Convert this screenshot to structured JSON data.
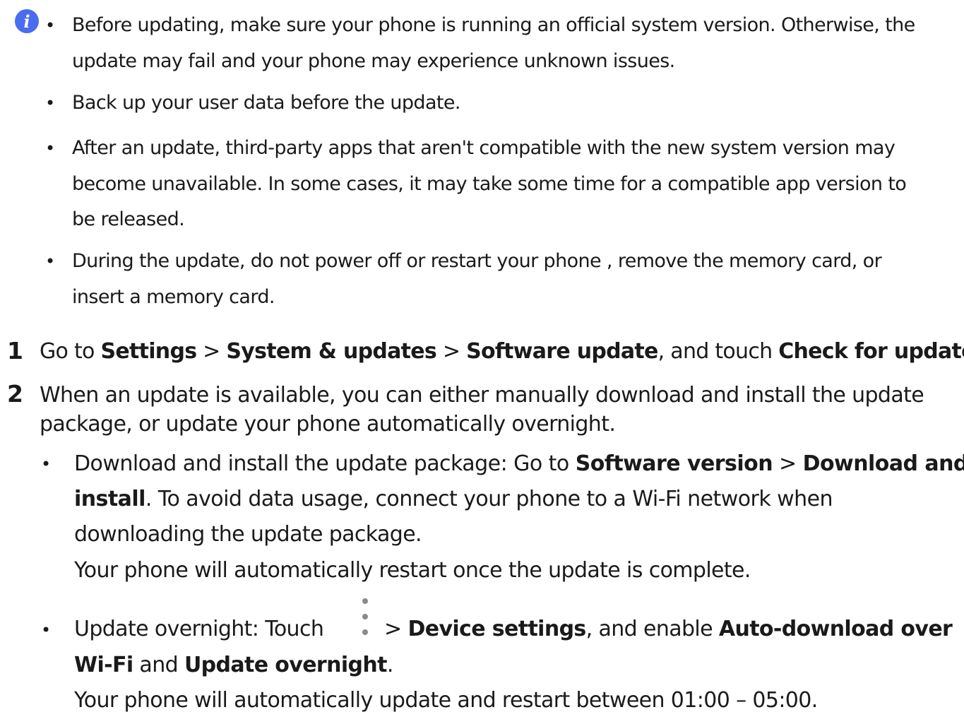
{
  "note": {
    "icon": "info-icon",
    "icon_letter": "i",
    "icon_color": "#4a6cf0",
    "bullet": "•",
    "items": [
      {
        "line1": "Before updating, make sure your phone is running an official system version. Otherwise, the",
        "line2": "update may fail and your phone may experience unknown issues."
      },
      {
        "line1": "Back up your user data before the update."
      },
      {
        "line1": "After an update, third-party apps that aren't compatible with the new system version may",
        "line2": "become unavailable. In some cases, it may take some time for a compatible app version to",
        "line3": "be released."
      },
      {
        "line1": "During the update, do not power off or restart your phone , remove the memory card, or",
        "line2": "insert a memory card."
      }
    ]
  },
  "steps": [
    {
      "number": "1",
      "p1": "Go to ",
      "b1": "Settings",
      "p2": " > ",
      "b2": "System & updates",
      "p3": " > ",
      "b3": "Software update",
      "p4": ", and touch ",
      "b4": "Check for updates",
      "p5": "."
    },
    {
      "number": "2",
      "line1": "When an update is available, you can either manually download and install the update",
      "line2": "package, or update your phone automatically overnight.",
      "bullets": [
        {
          "p1": "Download and install the update package: Go to ",
          "b1": "Software version",
          "p2": " > ",
          "b2a": "Download and",
          "b2b": "install",
          "p3": ". To avoid data usage, connect your phone to a Wi-Fi network when",
          "line3": "downloading the update package.",
          "line4": "Your phone will automatically restart once the update is complete."
        },
        {
          "p1": "Update overnight: Touch",
          "icon": "more-vertical-icon",
          "p2": " > ",
          "b1": "Device settings",
          "p3": ", and enable ",
          "b2a": "Auto-download over",
          "b2b": "Wi-Fi",
          "p4": " and ",
          "b3": "Update overnight",
          "p5": ".",
          "line3": "Your phone will automatically update and restart between 01:00 – 05:00."
        }
      ]
    }
  ],
  "bullet_char": "•"
}
